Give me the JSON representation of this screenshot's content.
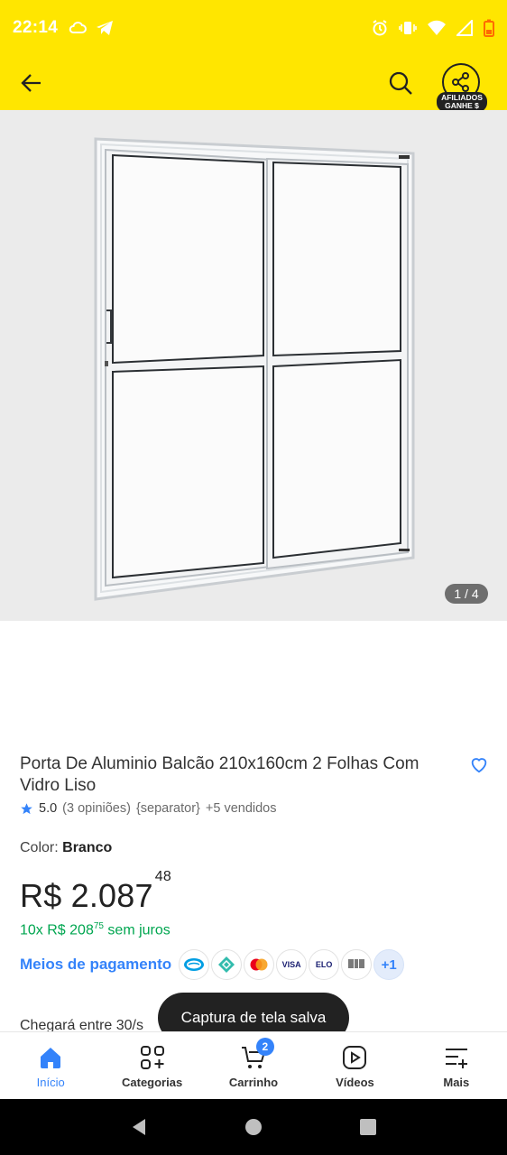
{
  "status_bar": {
    "time": "22:14"
  },
  "gallery": {
    "counter": "1 / 4"
  },
  "share": {
    "badge_line1": "AFILIADOS",
    "badge_line2": "GANHE $"
  },
  "product": {
    "title": "Porta De Aluminio Balcão 210x160cm 2 Folhas Com Vidro Liso",
    "rating": "5.0",
    "reviews": "(3 opiniões)",
    "separator": "{separator}",
    "sold": "+5 vendidos",
    "color_label": "Color:",
    "color_value": "Branco",
    "price_main": "R$ 2.087",
    "price_cents": "48",
    "installments_prefix": "10x R$ 208",
    "installments_cents": "75",
    "installments_suffix": " sem juros",
    "payment_link": "Meios de pagamento",
    "payment_methods": [
      "mercado-pago",
      "pix",
      "mastercard",
      "VISA",
      "ELO",
      "boleto"
    ],
    "payment_more": "+1",
    "delivery": "Chegará entre 30/s"
  },
  "toast": "Captura de tela salva",
  "bottom_nav": {
    "items": [
      {
        "label": "Início",
        "icon": "home-icon",
        "active": true
      },
      {
        "label": "Categorias",
        "icon": "categories-icon"
      },
      {
        "label": "Carrinho",
        "icon": "cart-icon",
        "badge": "2"
      },
      {
        "label": "Vídeos",
        "icon": "video-icon"
      },
      {
        "label": "Mais",
        "icon": "menu-plus-icon"
      }
    ]
  },
  "colors": {
    "brand_yellow": "#ffe600",
    "link_blue": "#3483fa",
    "green": "#00a650"
  }
}
